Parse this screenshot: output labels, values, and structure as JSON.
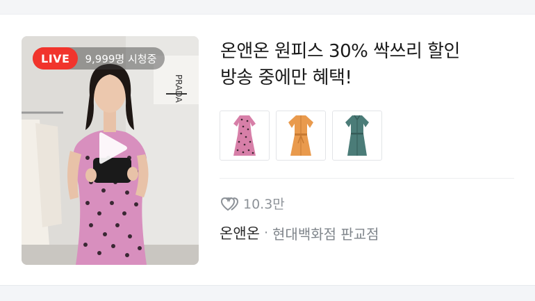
{
  "live": {
    "badge_label": "LIVE",
    "viewer_count": "9,999명 시청중"
  },
  "broadcast": {
    "title_line1": "온앤온 원피스 30% 싹쓰리 할인",
    "title_line2": "방송 중에만 혜택!"
  },
  "products": [
    {
      "icon": "pink-polka-dot-dress",
      "color": "#d77fa8"
    },
    {
      "icon": "orange-belted-dress",
      "color": "#e99a4d"
    },
    {
      "icon": "teal-shirt-dress",
      "color": "#4b7c78"
    }
  ],
  "stats": {
    "likes": "10.3만",
    "like_icon": "heart-icon"
  },
  "store": {
    "brand": "온앤온",
    "separator": "·",
    "branch": "현대백화점 판교점"
  },
  "colors": {
    "live_red": "#f1342c",
    "title_text": "#1a1a1a",
    "muted_text": "#8d9298"
  }
}
